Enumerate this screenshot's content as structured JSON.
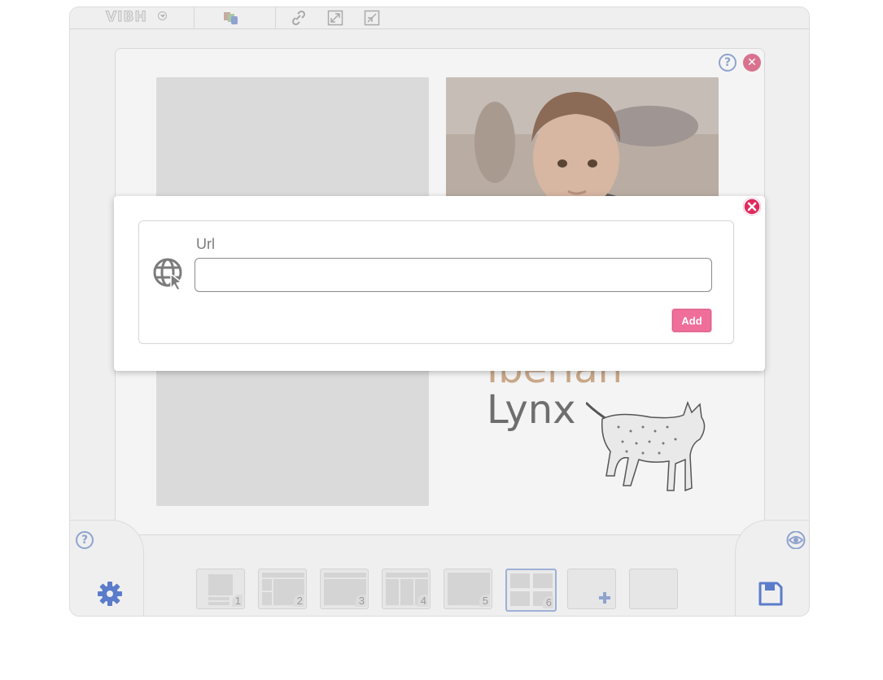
{
  "app": {
    "logo_text": "VIBH",
    "toolbar": {
      "icons": [
        "dropdown-caret-icon",
        "color-blocks-icon",
        "link-icon",
        "expand-icon",
        "shrink-icon"
      ]
    }
  },
  "page": {
    "lynx_title_line1": "Iberian",
    "lynx_title_line2": "Lynx"
  },
  "thumbnails": [
    {
      "number": "1"
    },
    {
      "number": "2"
    },
    {
      "number": "3"
    },
    {
      "number": "4"
    },
    {
      "number": "5"
    },
    {
      "number": "6",
      "active": true
    }
  ],
  "dialog": {
    "label": "Url",
    "input_value": "",
    "input_placeholder": "",
    "add_button": "Add"
  },
  "colors": {
    "accent_pink": "#ef6e9a",
    "close_red": "#e02a5c",
    "icon_blue": "#4f74c4"
  }
}
